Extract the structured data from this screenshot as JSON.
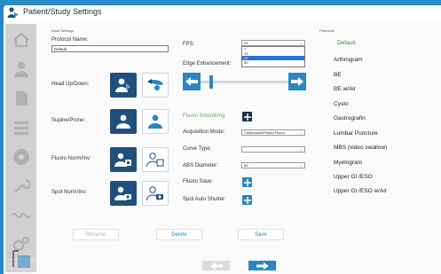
{
  "window": {
    "title": "Patient/Study Settings"
  },
  "sidebar": {
    "items": [
      {
        "icon": "home-icon"
      },
      {
        "icon": "user-icon"
      },
      {
        "icon": "document-icon"
      },
      {
        "icon": "list-icon"
      },
      {
        "icon": "disc-icon"
      },
      {
        "icon": "wrench-icon"
      },
      {
        "icon": "wave-icon"
      },
      {
        "icon": "gears-icon"
      },
      {
        "icon": "study-settings-icon",
        "selected": true
      }
    ]
  },
  "initial_settings": {
    "section_label": "Initial Settings",
    "protocol_name_label": "Protocol Name:",
    "protocol_name_value": "Default",
    "head_up_down_label": "Head Up/Down:",
    "supine_prone_label": "Supine/Prone:",
    "fluoro_norm_inv_label": "Fluoro Norm/Inv:",
    "spot_norm_inv_label": "Spot Norm/Inv:"
  },
  "settings": {
    "fps_label": "FPS:",
    "fps_value": "25",
    "fps_options": [
      "7",
      "15",
      "25",
      "30"
    ],
    "fps_highlighted": "25",
    "edge_enhancement_label": "Edge Enhancement:",
    "edge_enhancement_level": 0.12,
    "fluoro_smoothing_label": "Fluoro Smoothing",
    "acquisition_mode_label": "Acquisition Mode:",
    "acquisition_mode_value": "Continuous/Pulsed Fluoro",
    "curve_type_label": "Curve Type:",
    "curve_type_value": "",
    "abs_diameter_label": "ABS Diameter:",
    "abs_diameter_value": "60",
    "fluoro_save_label": "Fluoro Save:",
    "spot_auto_shutter_label": "Spot Auto Shutter:"
  },
  "protocols": {
    "section_label": "Protocols",
    "items": [
      "Default",
      "Arthrogram",
      "BE",
      "BE w/Air",
      "Cysto",
      "Gastrografin",
      "Lumbar Puncture",
      "MBS (video swallow)",
      "Myelogram",
      "Upper GI /ESO",
      "Upper GI /ESO w/Air"
    ],
    "selected": "Default"
  },
  "actions": {
    "rename_label": "Rename",
    "delete_label": "Delete",
    "save_label": "Save"
  },
  "colors": {
    "accent": "#2a86c4",
    "navy": "#1f4f7c",
    "selected_protocol": "#3e8a3e"
  }
}
